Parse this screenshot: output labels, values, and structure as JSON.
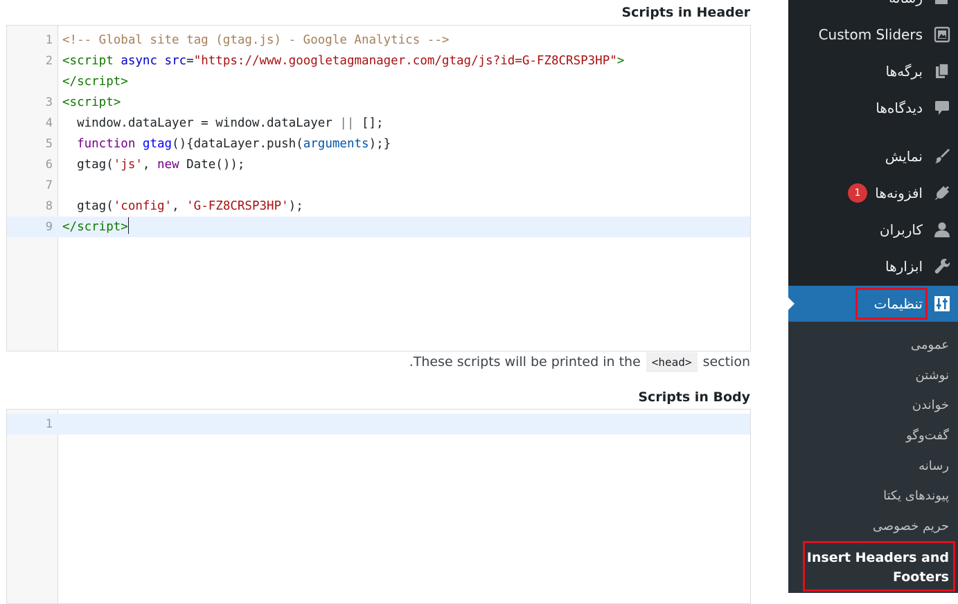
{
  "header_scripts": {
    "title": "Scripts in Header",
    "line_numbers": [
      "1",
      "2",
      "",
      "3",
      "4",
      "5",
      "6",
      "7",
      "8",
      "9"
    ],
    "hint_before": ".These scripts will be printed in the",
    "hint_code": "<head>",
    "hint_after": "section"
  },
  "body_scripts": {
    "title": "Scripts in Body",
    "line_numbers": [
      "1"
    ]
  },
  "sidebar": {
    "top_partial_label": "رسانه",
    "items": [
      {
        "label": "Custom Sliders",
        "icon": "slider-icon"
      },
      {
        "label": "برگه‌ها",
        "icon": "pages-icon"
      },
      {
        "label": "دیدگاه‌ها",
        "icon": "comments-icon"
      },
      {
        "label": "نمایش",
        "icon": "appearance-brush-icon"
      },
      {
        "label": "افزونه‌ها",
        "icon": "plugins-icon",
        "badge": "1"
      },
      {
        "label": "کاربران",
        "icon": "users-icon"
      },
      {
        "label": "ابزارها",
        "icon": "tools-wrench-icon"
      },
      {
        "label": "تنظیمات",
        "icon": "settings-icon"
      }
    ],
    "submenu": [
      "عمومی",
      "نوشتن",
      "خواندن",
      "گفت‌وگو",
      "رسانه",
      "پیوندهای یکتا",
      "حریم خصوصی"
    ],
    "submenu_current_line1": "Insert Headers and",
    "submenu_current_line2": "Footers"
  },
  "colors": {
    "sidebar_bg": "#1d2327",
    "submenu_bg": "#2c3338",
    "current_menu_bg": "#2271b1",
    "highlight_box": "#e0101e",
    "badge_bg": "#d63638",
    "active_line_bg": "#e8f2ff"
  }
}
